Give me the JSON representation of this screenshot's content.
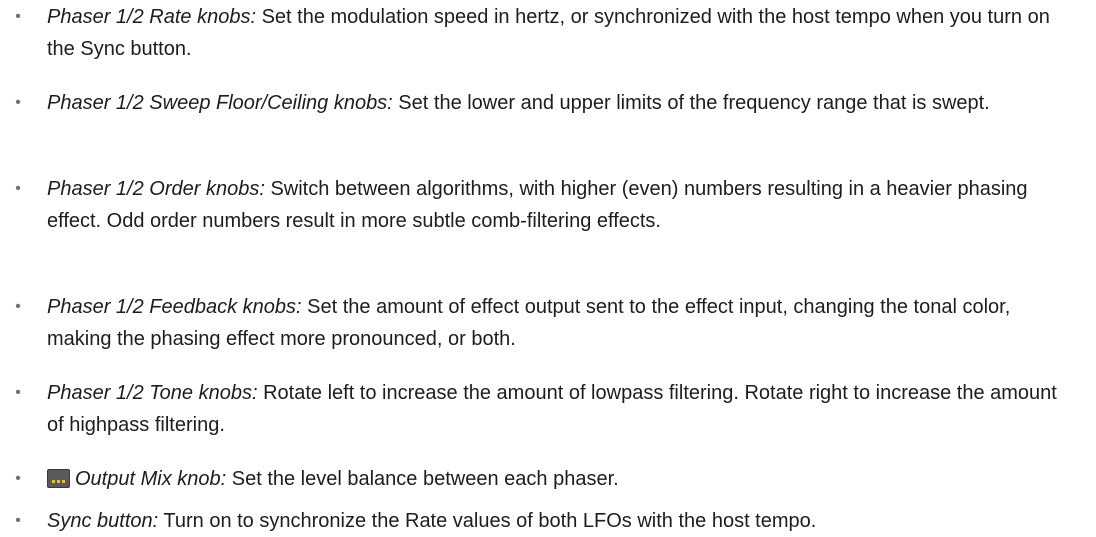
{
  "items": [
    {
      "term": "Phaser 1/2 Rate knobs:",
      "desc": " Set the modulation speed in hertz, or synchronized with the host tempo when you turn on the Sync button."
    },
    {
      "term": "Phaser 1/2 Sweep Floor/Ceiling knobs:",
      "desc": " Set the lower and upper limits of the frequency range that is swept."
    },
    {
      "term": "Phaser 1/2 Order knobs:",
      "desc": " Switch between algorithms, with higher (even) numbers resulting in a heavier phasing effect. Odd order numbers result in more subtle comb-filtering effects."
    },
    {
      "term": "Phaser 1/2 Feedback knobs:",
      "desc": " Set the amount of effect output sent to the effect input, changing the tonal color, making the phasing effect more pronounced, or both."
    },
    {
      "term": "Phaser 1/2 Tone knobs:",
      "desc": " Rotate left to increase the amount of lowpass filtering. Rotate right to increase the amount of highpass filtering."
    },
    {
      "icon": "output-mix-icon",
      "term": "Output Mix knob:",
      "desc": " Set the level balance between each phaser."
    },
    {
      "term": "Sync button:",
      "desc": " Turn on to synchronize the Rate values of both LFOs with the host tempo."
    }
  ],
  "bullet_char": "•"
}
